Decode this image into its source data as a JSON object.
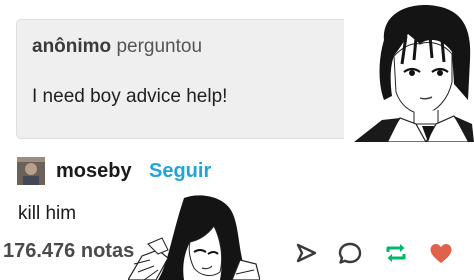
{
  "ask": {
    "asker_name": "anônimo",
    "asker_verb": "perguntou",
    "question": "I need boy advice help!"
  },
  "post": {
    "username": "moseby",
    "follow_label": "Seguir",
    "answer": "kill him",
    "notes_text": "176.476 notas"
  },
  "actions": {
    "icons": [
      "share-icon",
      "reply-icon",
      "reblog-icon",
      "like-icon"
    ],
    "reblog_color": "#00b86b",
    "like_color": "#e0614c",
    "follow_color": "#21a5d8"
  }
}
